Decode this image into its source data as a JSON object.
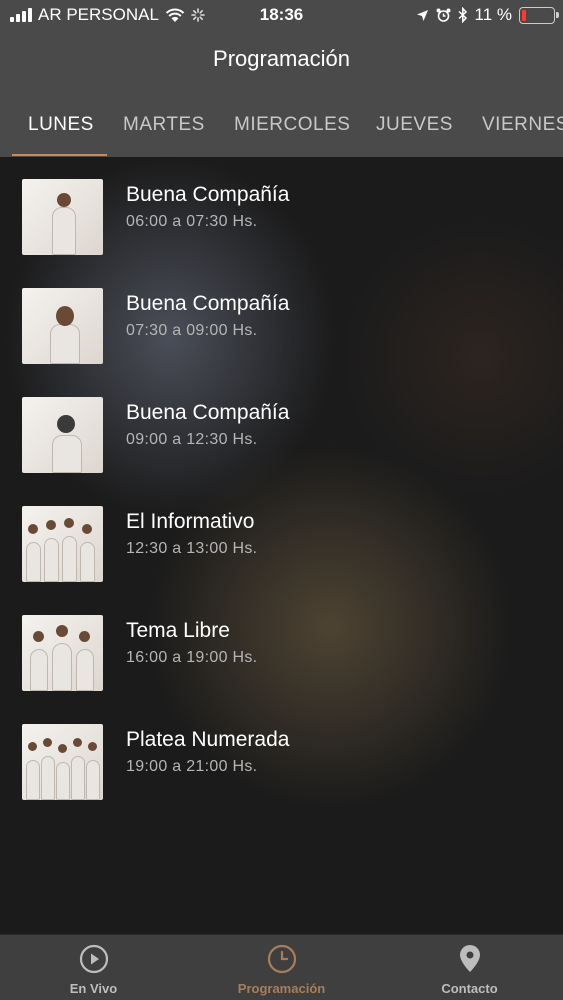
{
  "status": {
    "carrier": "AR PERSONAL",
    "time": "18:36",
    "battery": "11 %",
    "battery_level_pct": 11
  },
  "header": {
    "title": "Programación"
  },
  "tabs": [
    {
      "label": "LUNES",
      "active": true
    },
    {
      "label": "MARTES",
      "active": false
    },
    {
      "label": "MIERCOLES",
      "active": false
    },
    {
      "label": "JUEVES",
      "active": false
    },
    {
      "label": "VIERNES",
      "active": false
    }
  ],
  "schedule": [
    {
      "title": "Buena Compañía",
      "time": "06:00 a 07:30 Hs."
    },
    {
      "title": "Buena Compañía",
      "time": "07:30 a 09:00 Hs."
    },
    {
      "title": "Buena Compañía",
      "time": "09:00 a 12:30 Hs."
    },
    {
      "title": "El Informativo",
      "time": "12:30 a 13:00 Hs."
    },
    {
      "title": "Tema Libre",
      "time": "16:00 a 19:00 Hs."
    },
    {
      "title": "Platea Numerada",
      "time": "19:00 a 21:00 Hs."
    }
  ],
  "tabbar": {
    "items": [
      {
        "label": "En Vivo",
        "icon": "play-circle-icon",
        "active": false
      },
      {
        "label": "Programación",
        "icon": "clock-icon",
        "active": true
      },
      {
        "label": "Contacto",
        "icon": "map-pin-icon",
        "active": false
      }
    ]
  },
  "colors": {
    "accent": "#c58b5c",
    "tab_active": "#a87e5a",
    "header_bg": "#4a4a4a"
  }
}
